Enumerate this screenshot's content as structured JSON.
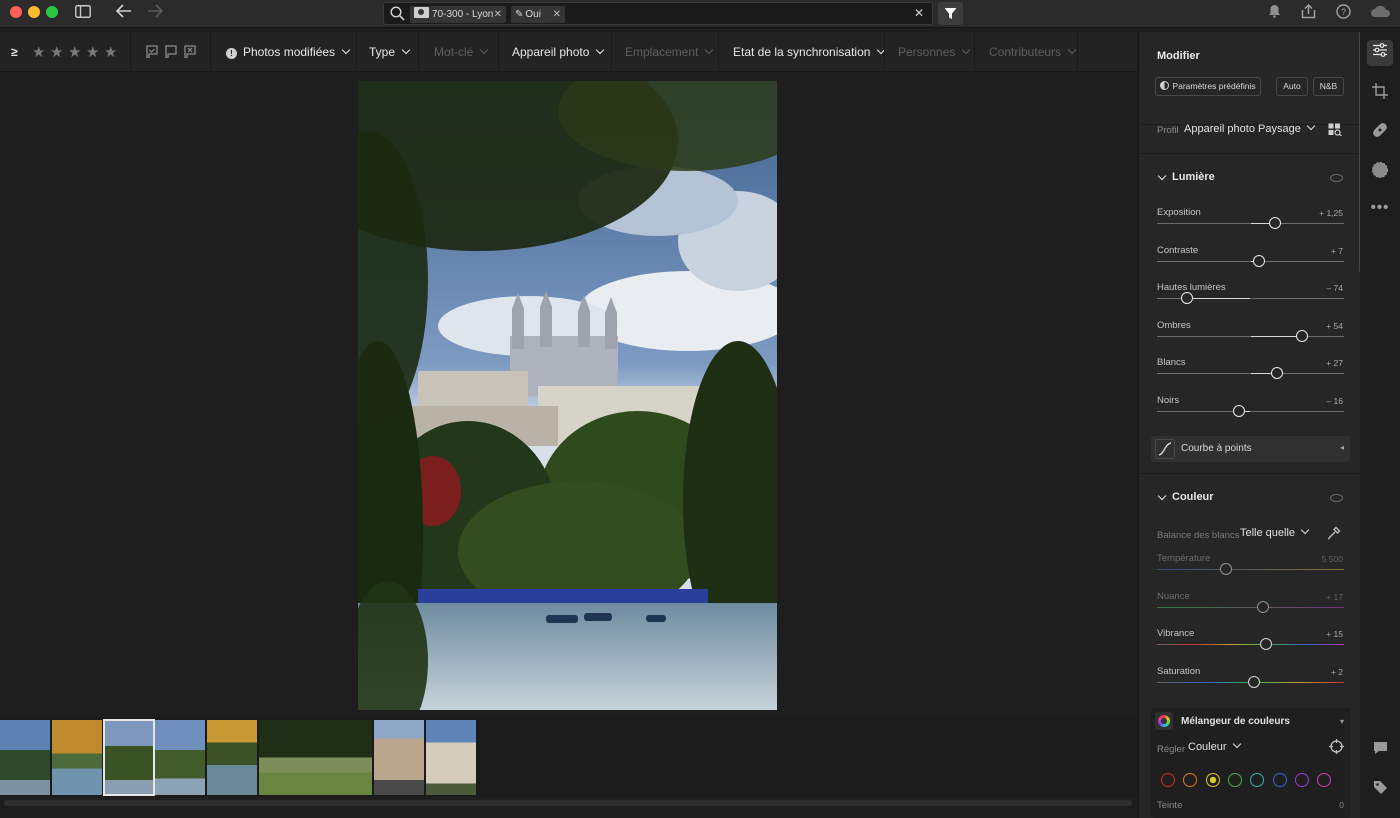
{
  "titlebar": {
    "back_icon": "arrow-left-icon",
    "forward_icon": "arrow-right-icon",
    "sidebar_icon": "sidebar-toggle-icon",
    "search_chips": [
      {
        "label": "70-300 - Lyon",
        "icon": "camera-lens-icon"
      },
      {
        "label": "Oui",
        "icon": "pencil-icon"
      }
    ],
    "clear_icon": "clear-search-icon",
    "filter_icon": "filter-funnel-icon",
    "right_icons": [
      "bell-icon",
      "share-icon",
      "help-icon",
      "cloud-icon"
    ]
  },
  "filterbar": {
    "compare_op": "≥",
    "stars": 5,
    "flags": [
      "flag-picked-icon",
      "flag-unflagged-icon",
      "flag-rejected-icon"
    ],
    "items": [
      {
        "label": "Photos modifiées",
        "enabled": true
      },
      {
        "label": "Type",
        "enabled": true
      },
      {
        "label": "Mot-clé",
        "enabled": false
      },
      {
        "label": "Appareil photo",
        "enabled": true
      },
      {
        "label": "Emplacement",
        "enabled": false
      },
      {
        "label": "Etat de la synchronisation",
        "enabled": true
      },
      {
        "label": "Personnes",
        "enabled": false
      },
      {
        "label": "Contributeurs",
        "enabled": false
      }
    ]
  },
  "panel": {
    "title": "Modifier",
    "preset_button": "Paramètres prédéfinis",
    "auto_button": "Auto",
    "bw_button": "N&B",
    "profile_label": "Profil",
    "profile_value": "Appareil photo Paysage",
    "light": {
      "title": "Lumière",
      "sliders": [
        {
          "label": "Exposition",
          "value": "+ 1,25",
          "pos": 0.632
        },
        {
          "label": "Contraste",
          "value": "+ 7",
          "pos": 0.548
        },
        {
          "label": "Hautes lumières",
          "value": "– 74",
          "pos": 0.158
        },
        {
          "label": "Ombres",
          "value": "+ 54",
          "pos": 0.774
        },
        {
          "label": "Blancs",
          "value": "+ 27",
          "pos": 0.642
        },
        {
          "label": "Noirs",
          "value": "– 16",
          "pos": 0.438
        }
      ],
      "curve_label": "Courbe à points"
    },
    "color": {
      "title": "Couleur",
      "wb_label": "Balance des blancs",
      "wb_value": "Telle quelle",
      "sliders": [
        {
          "label": "Température",
          "value": "5 500",
          "pos": 0.368,
          "dim": true
        },
        {
          "label": "Nuance",
          "value": "+ 17",
          "pos": 0.568,
          "dim": true
        },
        {
          "label": "Vibrance",
          "value": "+ 15",
          "pos": 0.584,
          "dim": false
        },
        {
          "label": "Saturation",
          "value": "+ 2",
          "pos": 0.52,
          "dim": false
        }
      ],
      "mixer_label": "Mélangeur de couleurs",
      "adjust_label": "Régler",
      "adjust_value": "Couleur",
      "swatches": [
        "#d12b2b",
        "#e07a21",
        "#d8c92a",
        "#3fb13f",
        "#2fb3b3",
        "#3a5fe0",
        "#8a3fe0",
        "#d03fc4"
      ],
      "hue_label": "Teinte",
      "hue_value": "0"
    }
  },
  "rail_icons": [
    "edit-sliders-icon",
    "crop-icon",
    "healing-bandage-icon",
    "masking-icon",
    "more-icon",
    "comment-icon",
    "tag-icon"
  ],
  "filmstrip": {
    "count": 8,
    "selected": 2
  }
}
